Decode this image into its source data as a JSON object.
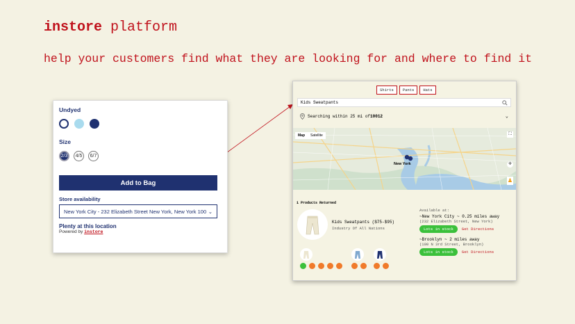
{
  "header": {
    "brand": "instore",
    "title_rest": " platform",
    "subtitle": "help your customers find what they are looking for and where to find it"
  },
  "product_panel": {
    "color_label": "Undyed",
    "swatches": [
      "#ffffff",
      "#a9dbee",
      "#1f3170"
    ],
    "size_label": "Size",
    "sizes": [
      "2/3",
      "4/5",
      "6/7"
    ],
    "add_to_bag": "Add to Bag",
    "store_availability_label": "Store availability",
    "store_selected": "New York City - 232 Elizabeth Street New York, New York 100",
    "plenty": "Plenty at this location",
    "powered_by": "Powered by",
    "powered_link": "instore"
  },
  "finder": {
    "tabs": [
      "Shirts",
      "Pants",
      "Hats"
    ],
    "search_value": "Kids Sweatpants",
    "location_text": "Searching within 25 mi of ",
    "location_zip": "10012",
    "map_tabs": [
      "Map",
      "Satellite"
    ],
    "map_city": "New York",
    "results_count": "1 Products Returned",
    "product_name": "Kids Sweatpants ($75-$95)",
    "product_brand": "Industry Of All Nations",
    "available_label": "Available at:",
    "stores": [
      {
        "name": "~New York City ~ 0.25 miles away",
        "addr": "(232 Elizabeth Street, New York)",
        "stock": "Lots in stock",
        "directions": "Get Directions"
      },
      {
        "name": "~Brooklyn ~ 2 miles away",
        "addr": "(100 N 3rd Street, Brooklyn)",
        "stock": "Lots in stock",
        "directions": "Get Directions"
      }
    ]
  },
  "colors": {
    "accent": "#c0121c",
    "navy": "#1f3170",
    "background": "#f4f2e3",
    "stock_green": "#3bc03b",
    "size_dot_orange": "#f07a2a"
  }
}
